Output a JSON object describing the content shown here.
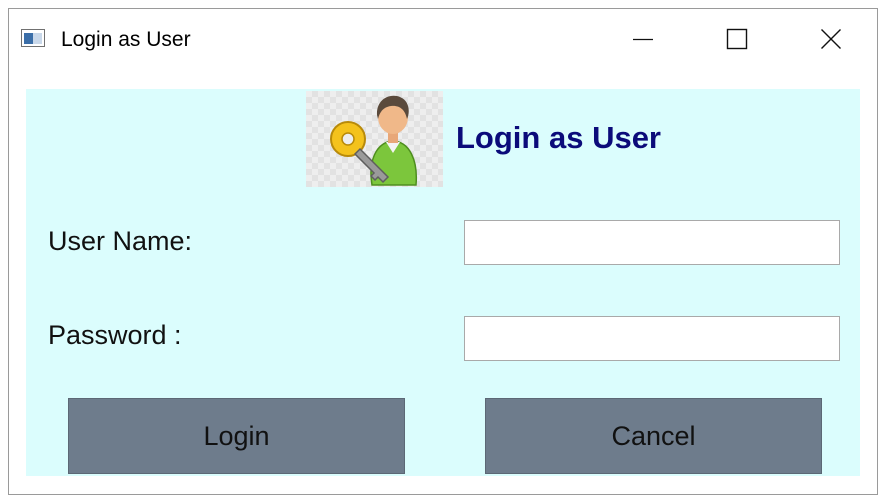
{
  "window": {
    "title": "Login as User",
    "icon": "window-app-icon",
    "controls": [
      "minimize-icon",
      "maximize-icon",
      "close-icon"
    ]
  },
  "form": {
    "heading": "Login as User",
    "logo_icon": "user-key-icon",
    "background_color": "#dbfdfd",
    "heading_color": "#0b0b7a",
    "username_label": "User Name:",
    "username_value": "",
    "password_label": "Password :",
    "password_value": "",
    "login_label": "Login",
    "cancel_label": "Cancel",
    "button_color": "#6e7c8c"
  }
}
